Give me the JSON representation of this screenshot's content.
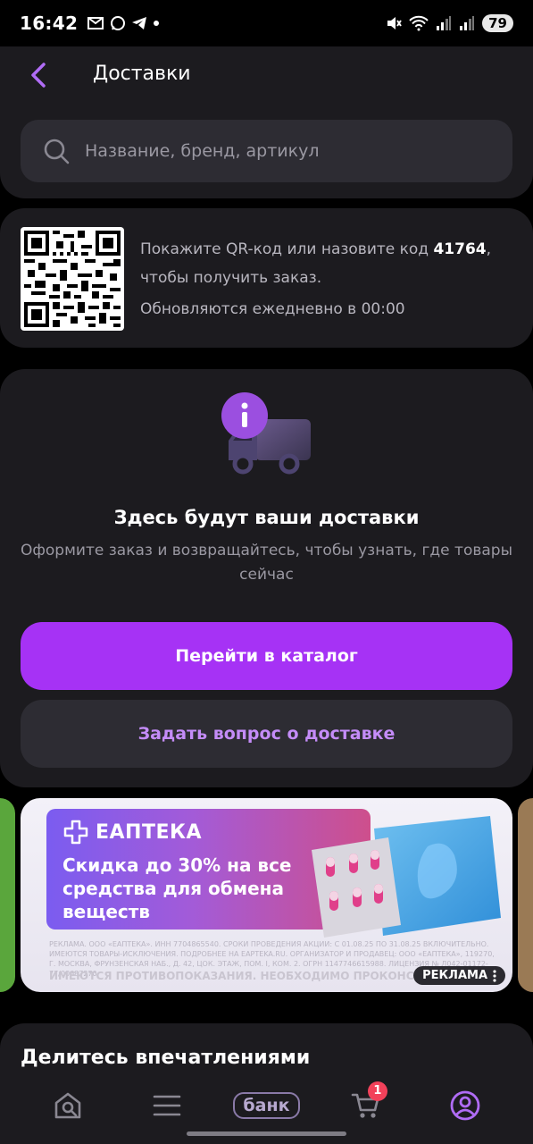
{
  "status_bar": {
    "time": "16:42",
    "left_icons": [
      "gmail-icon",
      "whatsapp-icon",
      "telegram-icon",
      "dot-icon"
    ],
    "right_icons": [
      "mute-icon",
      "wifi-icon",
      "signal-icon",
      "signal-icon"
    ],
    "battery": "79"
  },
  "header": {
    "title": "Доставки",
    "back_icon": "chevron-left-icon"
  },
  "search": {
    "placeholder": "Название, бренд, артикул"
  },
  "qr_card": {
    "text_before": "Покажите QR-код или назовите код ",
    "code": "41764",
    "text_after": ", чтобы получить заказ.",
    "update_note": "Обновляются ежедневно в 00:00"
  },
  "empty_state": {
    "title": "Здесь будут ваши доставки",
    "subtitle": "Оформите заказ и возвращайтесь, чтобы узнать, где товары сейчас",
    "catalog_button": "Перейти в каталог",
    "question_button": "Задать вопрос о доставке"
  },
  "banner": {
    "brand": "ЕАПТЕКА",
    "headline": "Скидка до 30% на все средства для обмена веществ",
    "legal_small": "РЕКЛАМА. ООО «ЕАПТЕКА». ИНН 7704865540. СРОКИ ПРОВЕДЕНИЯ АКЦИИ: С 01.08.25 ПО 31.08.25 ВКЛЮЧИТЕЛЬНО. ИМЕЮТСЯ ТОВАРЫ-ИСКЛЮЧЕНИЯ. ПОДРОБНЕЕ НА EAPTEKA.RU. ОРГАНИЗАТОР И ПРОДАВЕЦ: ООО «ЕАПТЕКА», 119270, Г. МОСКВА, ФРУНЗЕНСКАЯ НАБ., Д. 42, ЦОК. ЭТАЖ, ПОМ. I, КОМ. 2. ОГРН 1147746615988. ЛИЦЕНЗИЯ № Л042-01172-77/00687270.",
    "legal_warning": "ИМЕЮТСЯ ПРОТИВОПОКАЗАНИЯ. НЕОБХОДИМО ПРОКОНСУЛЬТИРОВАТЬСЯ СО СПЕЦИАЛИСТОМ",
    "ad_label": "РЕКЛАМА"
  },
  "share": {
    "title": "Делитесь впечатлениями"
  },
  "bottom_nav": {
    "bank_label": "банк",
    "cart_count": "1",
    "accent": "#a632f5"
  }
}
